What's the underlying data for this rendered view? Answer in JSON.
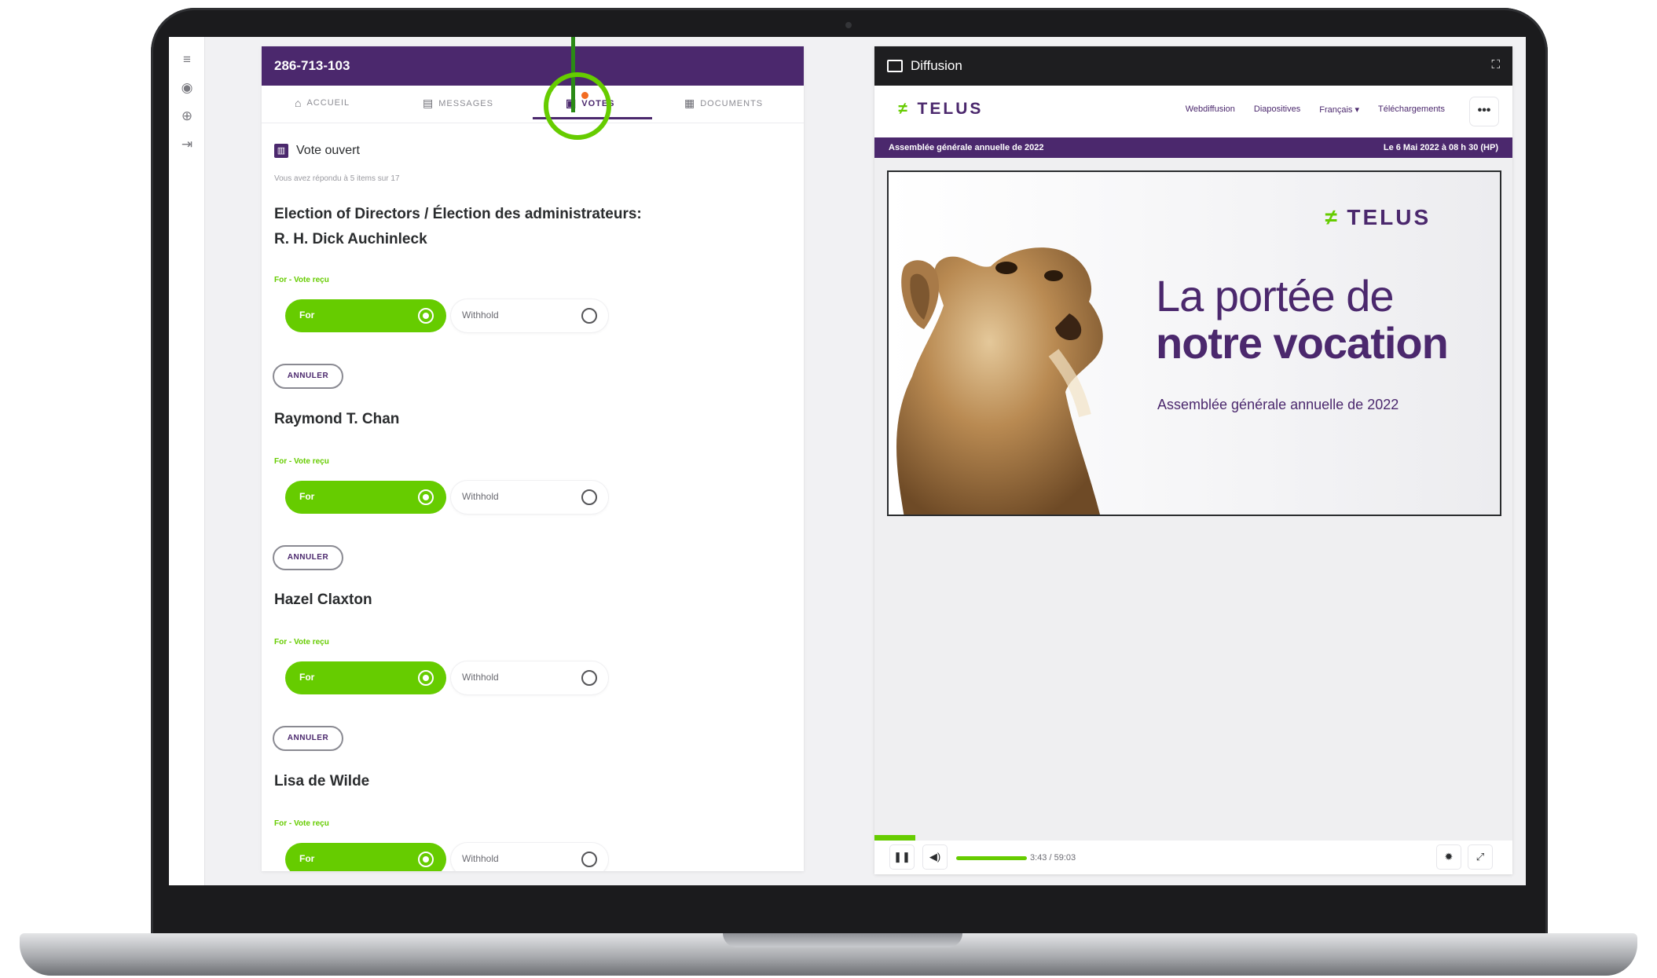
{
  "meeting_id": "286-713-103",
  "tabs": [
    {
      "label": "ACCUEIL",
      "icon": "home-icon"
    },
    {
      "label": "MESSAGES",
      "icon": "messages-icon"
    },
    {
      "label": "VOTES",
      "icon": "votes-icon"
    },
    {
      "label": "DOCUMENTS",
      "icon": "document-icon"
    }
  ],
  "vote_status": "Vote ouvert",
  "progress_note": "Vous avez répondu à 5 items sur 17",
  "section_title_line1": "Election of Directors / Élection des administrateurs:",
  "candidates": [
    {
      "name": "R. H. Dick Auchinleck",
      "status": "For - Vote reçu",
      "for_label": "For",
      "withhold_label": "Withhold",
      "cancel_label": "ANNULER"
    },
    {
      "name": "Raymond T. Chan",
      "status": "For - Vote reçu",
      "for_label": "For",
      "withhold_label": "Withhold",
      "cancel_label": "ANNULER"
    },
    {
      "name": "Hazel Claxton",
      "status": "For - Vote reçu",
      "for_label": "For",
      "withhold_label": "Withhold",
      "cancel_label": "ANNULER"
    },
    {
      "name": "Lisa de Wilde",
      "status": "For - Vote reçu",
      "for_label": "For",
      "withhold_label": "Withhold"
    }
  ],
  "broadcast": {
    "title": "Diffusion",
    "logo": "TELUS",
    "nav_links": [
      "Webdiffusion",
      "Diapositives",
      "Français ▾",
      "Téléchargements"
    ],
    "more_label": "•••",
    "event_name": "Assemblée générale annuelle de 2022",
    "event_date": "Le 6 Mai 2022 à 08 h 30 (HP)",
    "slide_logo": "TELUS",
    "slide_title_light": "La portée de",
    "slide_title_bold": "notre vocation",
    "slide_subtitle": "Assemblée générale annuelle de 2022",
    "time": "3:43 / 59:03"
  },
  "colors": {
    "purple": "#4b286d",
    "green": "#66cc00",
    "highlight": "#66cc00"
  }
}
